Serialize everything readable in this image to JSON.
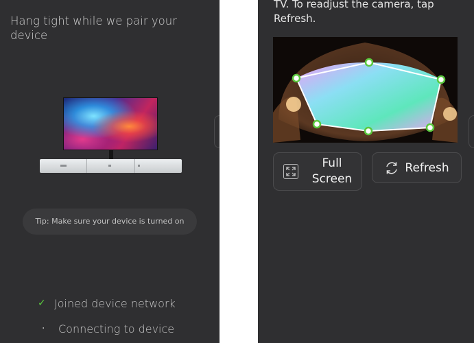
{
  "left": {
    "title": "Hang tight while we pair your device",
    "tip": "Tip: Make sure your device is turned on",
    "steps": [
      {
        "label": "Joined device network",
        "icon": "check-icon",
        "status": "done"
      },
      {
        "label": "Connecting to device",
        "icon": "spinner-dot-icon",
        "status": "in-progress"
      }
    ]
  },
  "right": {
    "instructions": "TV. To readjust the camera, tap Refresh.",
    "buttons": {
      "fullscreen_label": "Full Screen",
      "refresh_label": "Refresh"
    }
  },
  "colors": {
    "panel_bg": "#2f2f31",
    "accent_check": "#5bc93e",
    "overlay_line": "#ffffff",
    "control_point": "#5bc93e"
  }
}
